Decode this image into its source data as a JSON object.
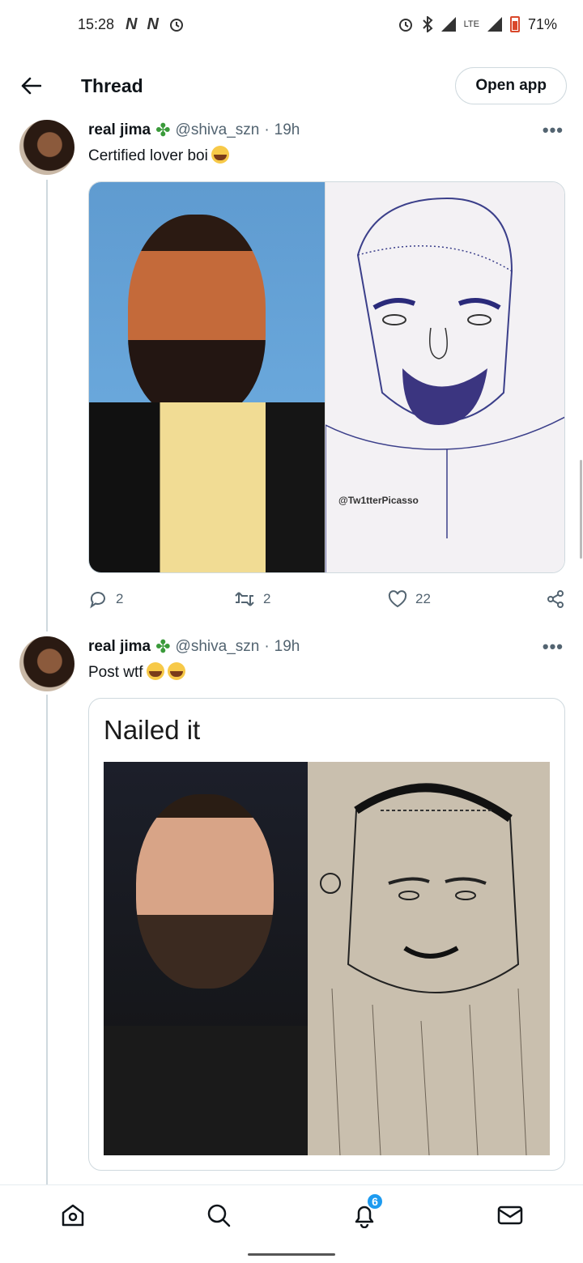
{
  "status_bar": {
    "time": "15:28",
    "battery": "71%",
    "network": "LTE"
  },
  "header": {
    "title": "Thread",
    "open_app": "Open app"
  },
  "tweets": [
    {
      "name": "real jima",
      "handle": "@shiva_szn",
      "separator": "·",
      "time": "19h",
      "text": "Certified lover boi",
      "watermark": "@Tw1tterPicasso",
      "reply_count": "2",
      "retweet_count": "2",
      "like_count": "22"
    },
    {
      "name": "real jima",
      "handle": "@shiva_szn",
      "separator": "·",
      "time": "19h",
      "text": "Post wtf",
      "image_caption": "Nailed it"
    }
  ],
  "bottom_nav": {
    "notifications_badge": "6"
  },
  "icons": [
    "back-arrow-icon",
    "clover-icon",
    "more-icon",
    "reply-icon",
    "retweet-icon",
    "like-icon",
    "share-icon",
    "home-icon",
    "search-icon",
    "notifications-icon",
    "messages-icon"
  ]
}
